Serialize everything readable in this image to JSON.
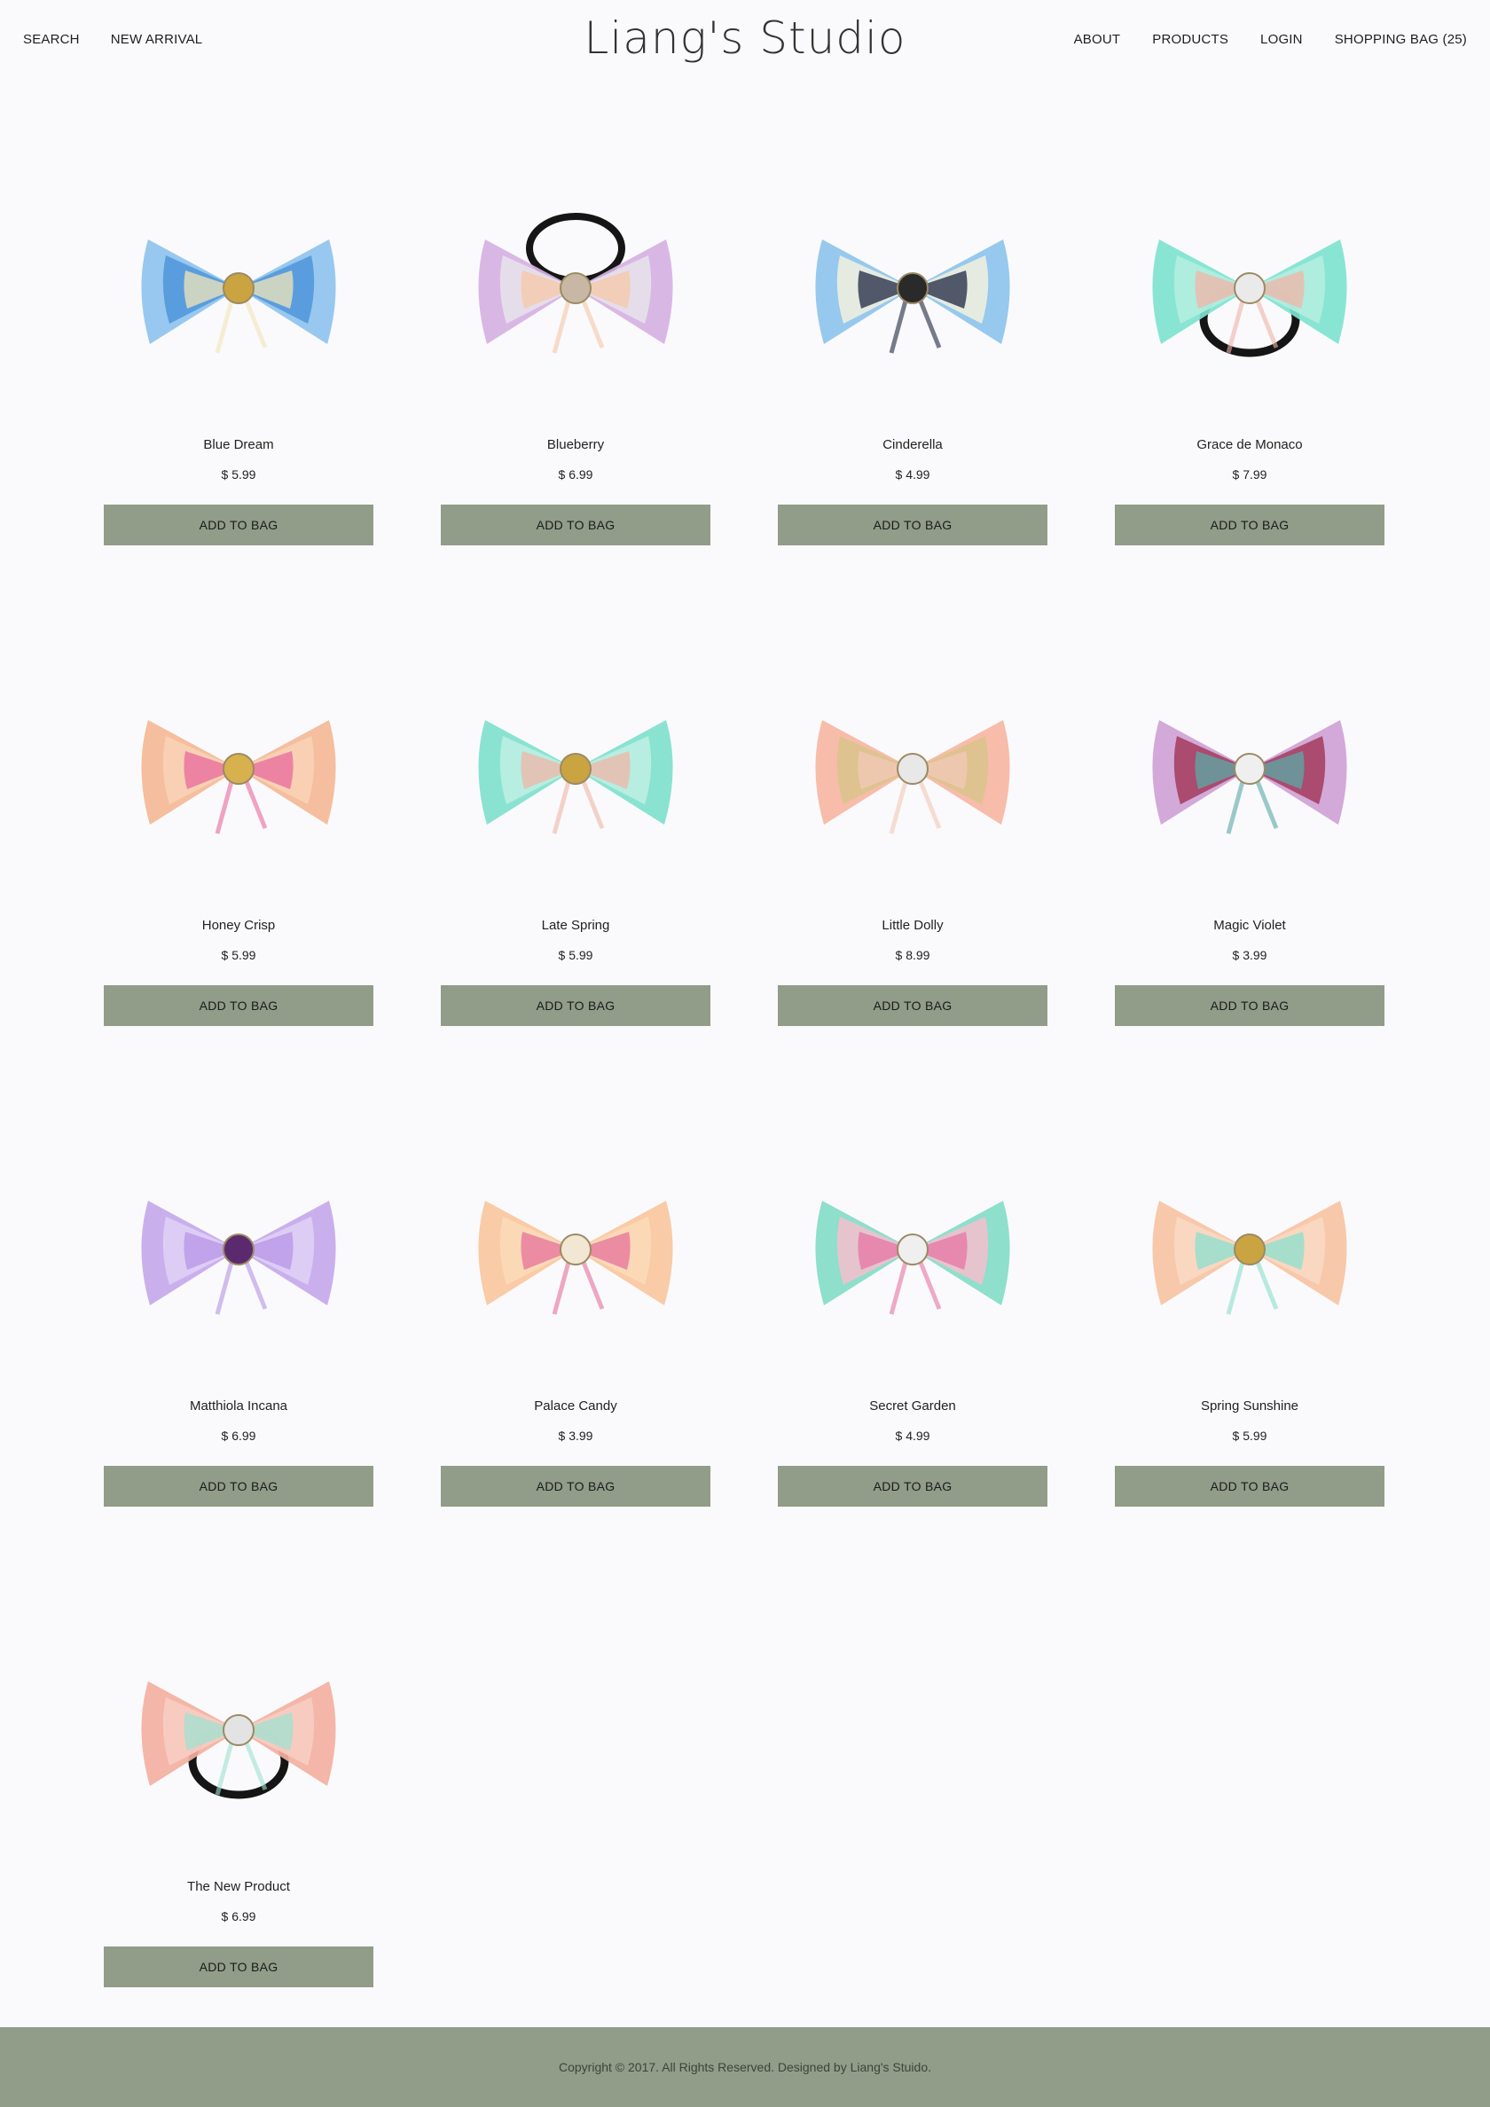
{
  "header": {
    "logo": "Liang's Studio",
    "nav_left": [
      {
        "name": "nav-search",
        "label": "SEARCH"
      },
      {
        "name": "nav-new-arrival",
        "label": "NEW ARRIVAL"
      }
    ],
    "nav_right": [
      {
        "name": "nav-about",
        "label": "ABOUT"
      },
      {
        "name": "nav-products",
        "label": "PRODUCTS"
      },
      {
        "name": "nav-login",
        "label": "LOGIN"
      },
      {
        "name": "nav-shopping-bag",
        "label": "SHOPPING BAG (25)"
      }
    ]
  },
  "add_to_bag_label": "ADD TO BAG",
  "products": [
    {
      "name": "Blue Dream",
      "price": "$ 5.99",
      "colors": [
        "#8fc3ee",
        "#f2e6b8",
        "#4d95da"
      ],
      "center": "#caa441",
      "band": false
    },
    {
      "name": "Blueberry",
      "price": "$ 6.99",
      "colors": [
        "#d6b1e3",
        "#f6c7a6",
        "#e7e4ec"
      ],
      "center": "#c9b7a6",
      "band": "top"
    },
    {
      "name": "Cinderella",
      "price": "$ 4.99",
      "colors": [
        "#8dc4ec",
        "#1e2740",
        "#f3f1de"
      ],
      "center": "#2a2a2a",
      "band": false
    },
    {
      "name": "Grace de Monaco",
      "price": "$ 7.99",
      "colors": [
        "#7fe3cf",
        "#f1b4a8",
        "#b6efe0"
      ],
      "center": "#eaeaea",
      "band": "bottom"
    },
    {
      "name": "Honey Crisp",
      "price": "$ 5.99",
      "colors": [
        "#f4b896",
        "#e86a9c",
        "#f9d4b6"
      ],
      "center": "#d7b14d",
      "band": false
    },
    {
      "name": "Late Spring",
      "price": "$ 5.99",
      "colors": [
        "#7fe1cc",
        "#f0b6a8",
        "#bff0e4"
      ],
      "center": "#caa441",
      "band": false
    },
    {
      "name": "Little Dolly",
      "price": "$ 8.99",
      "colors": [
        "#f7b6a3",
        "#f3c9b8",
        "#d9c48d"
      ],
      "center": "#e8e8e8",
      "band": false
    },
    {
      "name": "Magic Violet",
      "price": "$ 3.99",
      "colors": [
        "#cfa2d6",
        "#5aa9a4",
        "#a23b5c"
      ],
      "center": "#efefef",
      "band": false
    },
    {
      "name": "Matthiola Incana",
      "price": "$ 6.99",
      "colors": [
        "#c6a8ec",
        "#b694e6",
        "#e0d2f6"
      ],
      "center": "#5b2a6e",
      "band": false
    },
    {
      "name": "Palace Candy",
      "price": "$ 3.99",
      "colors": [
        "#f8c79e",
        "#e6719b",
        "#fbdcba"
      ],
      "center": "#f1e7d2",
      "band": false
    },
    {
      "name": "Secret Garden",
      "price": "$ 4.99",
      "colors": [
        "#84dcc8",
        "#e774a4",
        "#f4c0ce"
      ],
      "center": "#efefef",
      "band": false
    },
    {
      "name": "Spring Sunshine",
      "price": "$ 5.99",
      "colors": [
        "#f7c3a4",
        "#8be0cd",
        "#f9d9c4"
      ],
      "center": "#caa441",
      "band": false
    },
    {
      "name": "The New Product",
      "price": "$ 6.99",
      "colors": [
        "#f3b0a1",
        "#9fe2d1",
        "#f8cfc4"
      ],
      "center": "#e3e3e3",
      "band": "bottom"
    }
  ],
  "footer": {
    "copyright": "Copyright © 2017. All Rights Reserved. Designed by Liang's Stuido."
  }
}
